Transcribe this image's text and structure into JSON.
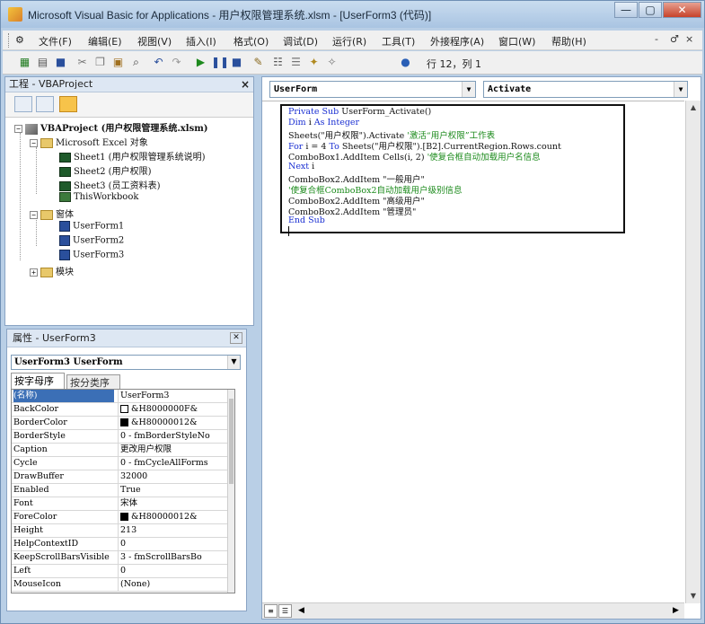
{
  "window": {
    "title": "Microsoft Visual Basic for Applications - 用户权限管理系统.xlsm - [UserForm3 (代码)]",
    "controls": [
      "—",
      "▢",
      "✕"
    ]
  },
  "menubar": {
    "items": [
      "文件(F)",
      "编辑(E)",
      "视图(V)",
      "插入(I)",
      "格式(O)",
      "调试(D)",
      "运行(R)",
      "工具(T)",
      "外接程序(A)",
      "窗口(W)",
      "帮助(H)"
    ],
    "mdi_controls": [
      "-",
      "♂",
      "×"
    ]
  },
  "toolbar": {
    "position": "行 12，列 1"
  },
  "project": {
    "title": "工程 - VBAProject",
    "close": "×",
    "root": "VBAProject (用户权限管理系统.xlsm)",
    "excel_folder": "Microsoft Excel 对象",
    "sheets": [
      "Sheet1 (用户权限管理系统说明)",
      "Sheet2 (用户权限)",
      "Sheet3 (员工资料表)",
      "ThisWorkbook"
    ],
    "forms_folder": "窗体",
    "forms": [
      "UserForm1",
      "UserForm2",
      "UserForm3"
    ],
    "modules_folder": "模块"
  },
  "properties": {
    "title": "属性 - UserForm3",
    "close": "✕",
    "object": "UserForm3 UserForm",
    "tabs": [
      "按字母序",
      "按分类序"
    ],
    "rows": [
      {
        "name": "(名称)",
        "value": "UserForm3"
      },
      {
        "name": "BackColor",
        "value": "&H8000000F&",
        "swatch": "#ffffff"
      },
      {
        "name": "BorderColor",
        "value": "&H80000012&",
        "swatch": "#000000"
      },
      {
        "name": "BorderStyle",
        "value": "0 - fmBorderStyleNo"
      },
      {
        "name": "Caption",
        "value": "更改用户权限"
      },
      {
        "name": "Cycle",
        "value": "0 - fmCycleAllForms"
      },
      {
        "name": "DrawBuffer",
        "value": "32000"
      },
      {
        "name": "Enabled",
        "value": "True"
      },
      {
        "name": "Font",
        "value": "宋体"
      },
      {
        "name": "ForeColor",
        "value": "&H80000012&",
        "swatch": "#000000"
      },
      {
        "name": "Height",
        "value": "213"
      },
      {
        "name": "HelpContextID",
        "value": "0"
      },
      {
        "name": "KeepScrollBarsVisible",
        "value": "3 - fmScrollBarsBo"
      },
      {
        "name": "Left",
        "value": "0"
      },
      {
        "name": "MouseIcon",
        "value": "(None)"
      }
    ]
  },
  "code": {
    "object_combo": "UserForm",
    "proc_combo": "Activate",
    "lines": [
      [
        {
          "t": "Private Sub ",
          "c": "kw"
        },
        {
          "t": "UserForm_Activate()",
          "c": ""
        }
      ],
      [
        {
          "t": "Dim ",
          "c": "kw"
        },
        {
          "t": "i ",
          "c": ""
        },
        {
          "t": "As Integer",
          "c": "kw"
        }
      ],
      [
        {
          "t": "Sheets(\"用户权限\").Activate ",
          "c": ""
        },
        {
          "t": "'激活“用户权限”工作表",
          "c": "cm"
        }
      ],
      [
        {
          "t": "For ",
          "c": "kw"
        },
        {
          "t": "i = 4 ",
          "c": ""
        },
        {
          "t": "To ",
          "c": "kw"
        },
        {
          "t": "Sheets(\"用户权限\").[B2].CurrentRegion.Rows.count",
          "c": ""
        }
      ],
      [
        {
          "t": "    ComboBox1.AddItem Cells(i, 2) ",
          "c": ""
        },
        {
          "t": "'使复合框自动加载用户名信息",
          "c": "cm"
        }
      ],
      [
        {
          "t": "Next ",
          "c": "kw"
        },
        {
          "t": "i",
          "c": ""
        }
      ],
      [
        {
          "t": "ComboBox2.AddItem \"一般用户\"",
          "c": ""
        }
      ],
      [
        {
          "t": "  '使复合框ComboBox2自动加载用户级别信息",
          "c": "cm"
        }
      ],
      [
        {
          "t": "ComboBox2.AddItem \"高级用户\"",
          "c": ""
        }
      ],
      [
        {
          "t": "ComboBox2.AddItem \"管理员\"",
          "c": ""
        }
      ],
      [
        {
          "t": "End Sub",
          "c": "kw"
        }
      ]
    ]
  }
}
